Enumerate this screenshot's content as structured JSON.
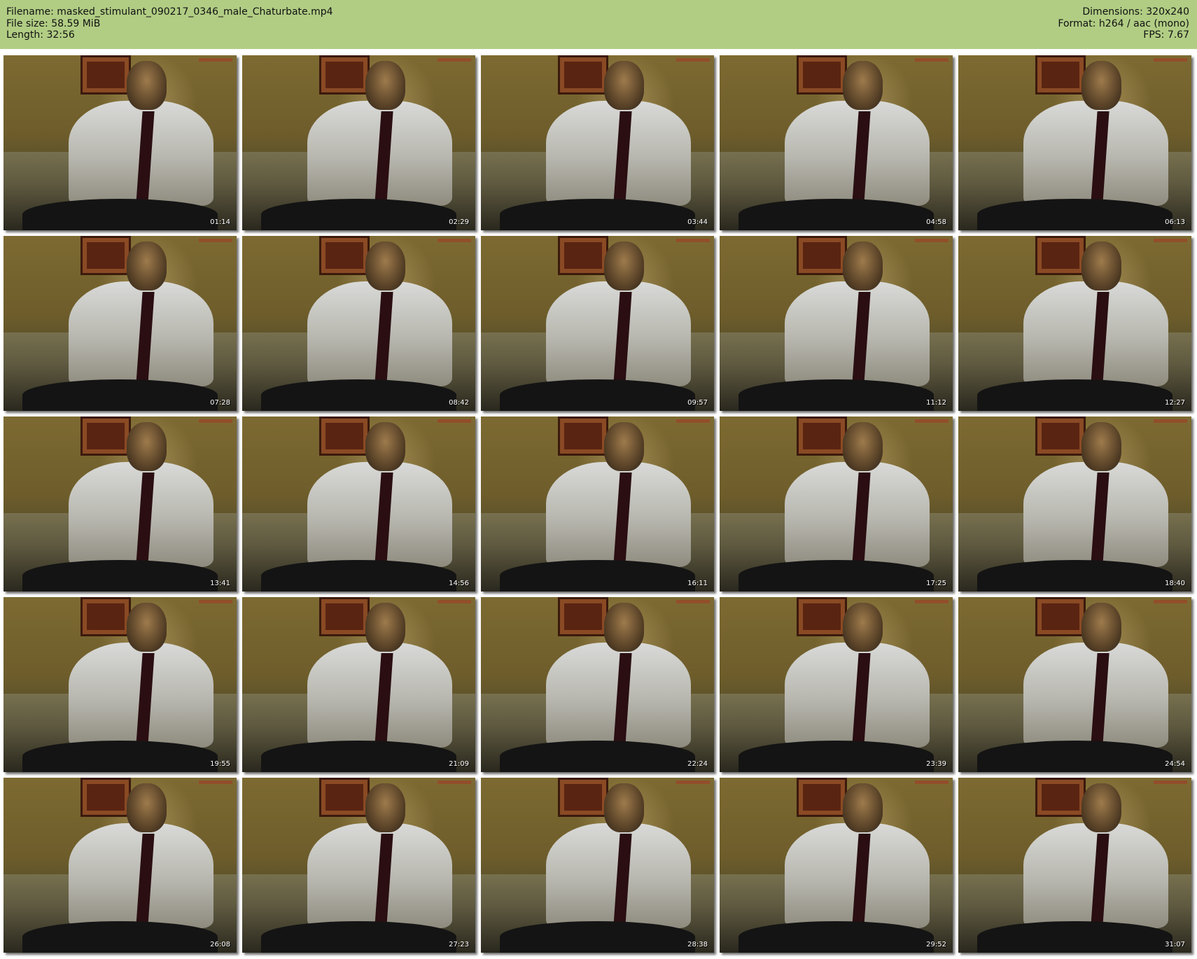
{
  "header": {
    "filename_line": "Filename: masked_stimulant_090217_0346_male_Chaturbate.mp4",
    "filesize_line": "File size: 58.59 MiB",
    "length_line": "Length: 32:56",
    "dimensions_line": "Dimensions: 320x240",
    "format_line": "Format: h264 / aac (mono)",
    "fps_line": "FPS: 7.67"
  },
  "thumbnails": [
    {
      "timestamp": "01:14"
    },
    {
      "timestamp": "02:29"
    },
    {
      "timestamp": "03:44"
    },
    {
      "timestamp": "04:58"
    },
    {
      "timestamp": "06:13"
    },
    {
      "timestamp": "07:28"
    },
    {
      "timestamp": "08:42"
    },
    {
      "timestamp": "09:57"
    },
    {
      "timestamp": "11:12"
    },
    {
      "timestamp": "12:27"
    },
    {
      "timestamp": "13:41"
    },
    {
      "timestamp": "14:56"
    },
    {
      "timestamp": "16:11"
    },
    {
      "timestamp": "17:25"
    },
    {
      "timestamp": "18:40"
    },
    {
      "timestamp": "19:55"
    },
    {
      "timestamp": "21:09"
    },
    {
      "timestamp": "22:24"
    },
    {
      "timestamp": "23:39"
    },
    {
      "timestamp": "24:54"
    },
    {
      "timestamp": "26:08"
    },
    {
      "timestamp": "27:23"
    },
    {
      "timestamp": "28:38"
    },
    {
      "timestamp": "29:52"
    },
    {
      "timestamp": "31:07"
    }
  ],
  "colors": {
    "header_background": "#b1cd84",
    "page_background": "#ffffff",
    "timestamp_text": "#ffffff"
  }
}
